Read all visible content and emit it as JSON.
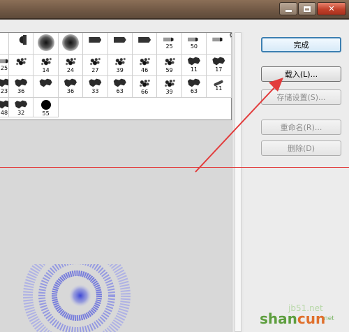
{
  "window": {
    "controls": [
      "minimize",
      "maximize",
      "close"
    ]
  },
  "brushes": {
    "rows": [
      [
        {
          "shape": "fan",
          "size": ""
        },
        {
          "shape": "round",
          "size": ""
        },
        {
          "shape": "round",
          "size": ""
        },
        {
          "shape": "marker",
          "size": ""
        },
        {
          "shape": "marker",
          "size": ""
        },
        {
          "shape": "marker",
          "size": ""
        },
        {
          "shape": "pen",
          "size": "25"
        },
        {
          "shape": "pen",
          "size": "50"
        },
        {
          "shape": "pen",
          "size": ""
        },
        {
          "shape": "pen",
          "size": "25"
        }
      ],
      [
        {
          "shape": "splat",
          "size": ""
        },
        {
          "shape": "splat",
          "size": "14"
        },
        {
          "shape": "splat",
          "size": "24"
        },
        {
          "shape": "splat",
          "size": "27"
        },
        {
          "shape": "splat",
          "size": "39"
        },
        {
          "shape": "splat",
          "size": "46"
        },
        {
          "shape": "splat",
          "size": "59"
        },
        {
          "shape": "blob",
          "size": "11"
        },
        {
          "shape": "blob",
          "size": "17"
        },
        {
          "shape": "blob",
          "size": "23"
        },
        {
          "shape": "blob",
          "size": "36"
        }
      ],
      [
        {
          "shape": "blob",
          "size": ""
        },
        {
          "shape": "blob",
          "size": "36"
        },
        {
          "shape": "blob",
          "size": "33"
        },
        {
          "shape": "blob",
          "size": "63"
        },
        {
          "shape": "splat",
          "size": "66"
        },
        {
          "shape": "splat",
          "size": "39"
        },
        {
          "shape": "blob",
          "size": "63"
        },
        {
          "shape": "streak",
          "size": "11"
        },
        {
          "shape": "blob",
          "size": "48"
        },
        {
          "shape": "blob",
          "size": "32"
        },
        {
          "shape": "dot",
          "size": "55"
        }
      ]
    ]
  },
  "buttons": {
    "done": "完成",
    "load": "载入(L)...",
    "save": "存储设置(S)...",
    "rename": "重命名(R)...",
    "delete": "删除(D)"
  },
  "watermark": {
    "site": "jb51.net",
    "brand_a": "shan",
    "brand_b": "cun",
    "sub": "net"
  },
  "colors": {
    "annotation_red": "#e23b3b",
    "default_button_border": "#3c7fb1"
  }
}
